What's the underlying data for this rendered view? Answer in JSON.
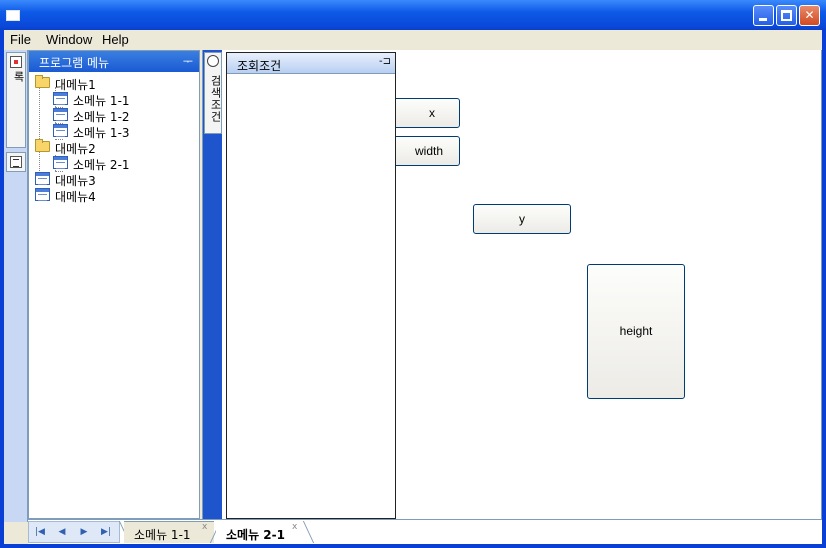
{
  "menubar": {
    "file": "File",
    "window": "Window",
    "help": "Help"
  },
  "side_strip": {
    "program_menu_tab": "프로그램 목록"
  },
  "program_panel": {
    "title": "프로그램 메뉴",
    "pin": "ᅮ",
    "tree": [
      {
        "label": "대메뉴1",
        "type": "folder"
      },
      {
        "label": "소메뉴  1-1",
        "type": "item"
      },
      {
        "label": "소메뉴  1-2",
        "type": "item"
      },
      {
        "label": "소메뉴  1-3",
        "type": "item"
      },
      {
        "label": "대메뉴2",
        "type": "folder"
      },
      {
        "label": "소메뉴  2-1",
        "type": "item"
      },
      {
        "label": "대메뉴3",
        "type": "item"
      },
      {
        "label": "대메뉴4",
        "type": "item"
      }
    ]
  },
  "search_strip": {
    "tab_label": "검색조건"
  },
  "query_panel": {
    "title": "조회조건",
    "pin": "-⊐"
  },
  "buttons": {
    "x": "x",
    "width": "width",
    "y": "y",
    "height": "height"
  },
  "bottom_tabs": {
    "nav": [
      "|◀",
      "◀",
      "▶",
      "▶|"
    ],
    "tabs": [
      {
        "label": "소메뉴  1-1",
        "close": "x"
      },
      {
        "label": "소메뉴  2-1",
        "close": "x"
      }
    ]
  },
  "colors": {
    "titlebar": "#0a47d8",
    "panel_header": "#1a5ad4",
    "client_bg": "#ece9d8",
    "border": "#7f9db9"
  }
}
